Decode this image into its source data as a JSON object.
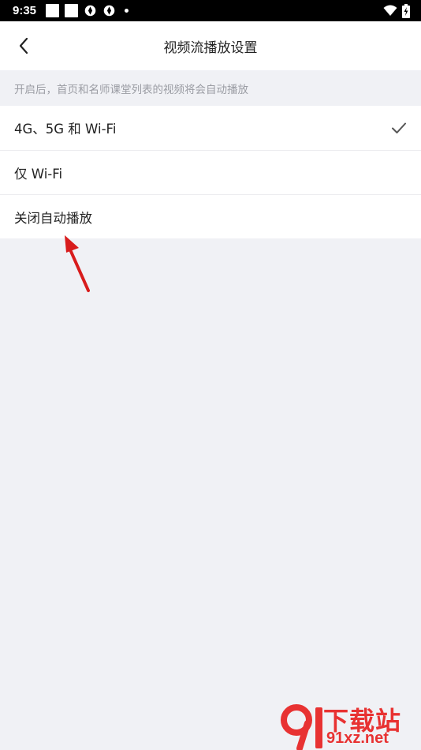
{
  "status_bar": {
    "time": "9:35"
  },
  "header": {
    "title": "视频流播放设置"
  },
  "hint": "开启后，首页和名师课堂列表的视频将会自动播放",
  "options": [
    {
      "label": "4G、5G 和 Wi-Fi",
      "selected": true
    },
    {
      "label": "仅 Wi-Fi",
      "selected": false
    },
    {
      "label": "关闭自动播放",
      "selected": false
    }
  ],
  "watermark": {
    "title": "下载站",
    "url": "91xz.net"
  },
  "colors": {
    "accent": "#e83232",
    "background": "#f0f1f5"
  }
}
